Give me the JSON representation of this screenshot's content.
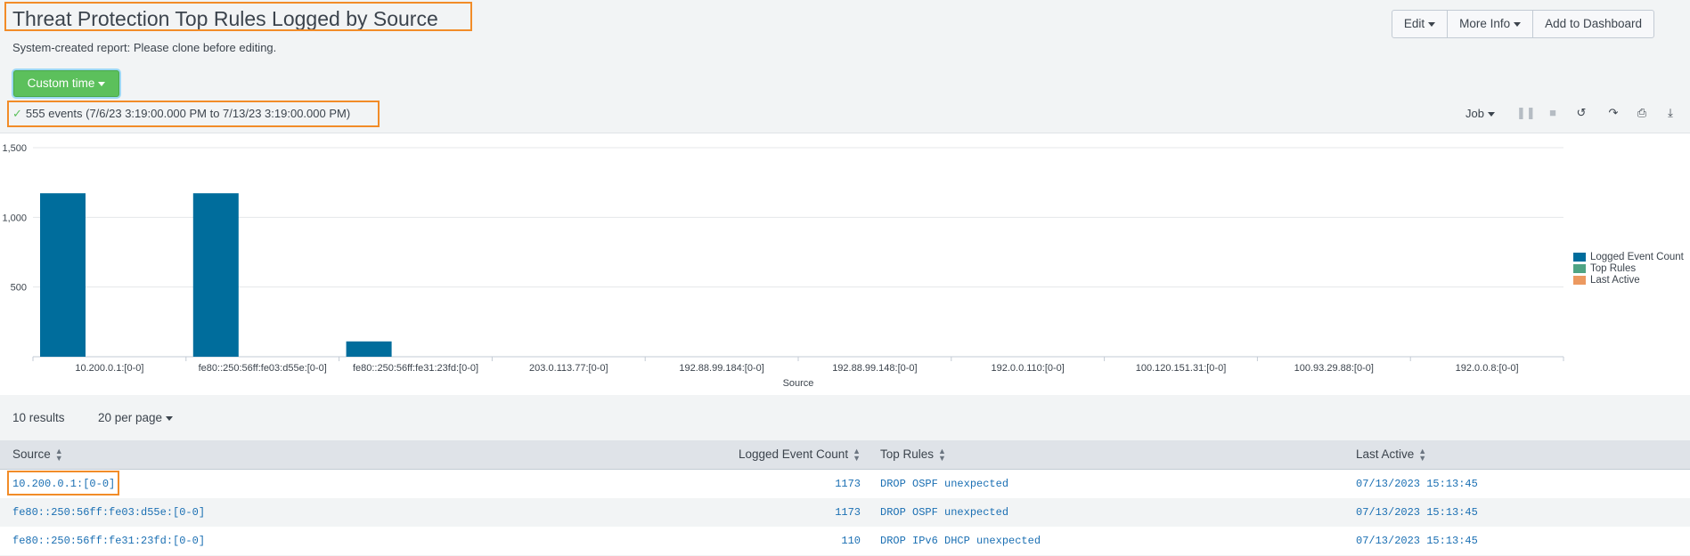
{
  "header": {
    "title": "Threat Protection Top Rules Logged by Source",
    "subtitle": "System-created report: Please clone before editing.",
    "buttons": {
      "edit": "Edit",
      "more_info": "More Info",
      "add_to_dashboard": "Add to Dashboard"
    }
  },
  "time_picker": {
    "label": "Custom time"
  },
  "status": {
    "events_text": "555 events (7/6/23 3:19:00.000 PM to 7/13/23 3:19:00.000 PM)"
  },
  "job_toolbar": {
    "job_label": "Job",
    "icons": [
      "pause-icon",
      "stop-icon",
      "refresh-icon",
      "share-icon",
      "print-icon",
      "export-icon"
    ]
  },
  "chart_data": {
    "type": "bar",
    "xlabel": "Source",
    "ylabel": "",
    "ylim": [
      0,
      1500
    ],
    "y_ticks": [
      "500",
      "1,000",
      "1,500"
    ],
    "categories": [
      "10.200.0.1:[0-0]",
      "fe80::250:56ff:fe03:d55e:[0-0]",
      "fe80::250:56ff:fe31:23fd:[0-0]",
      "203.0.113.77:[0-0]",
      "192.88.99.184:[0-0]",
      "192.88.99.148:[0-0]",
      "192.0.0.110:[0-0]",
      "100.120.151.31:[0-0]",
      "100.93.29.88:[0-0]",
      "192.0.0.8:[0-0]"
    ],
    "series": [
      {
        "name": "Logged Event Count",
        "color": "#006d9c",
        "values": [
          1173,
          1173,
          110,
          0,
          0,
          0,
          0,
          0,
          0,
          0
        ]
      },
      {
        "name": "Top Rules",
        "color": "#4fa484",
        "values": [
          0,
          0,
          0,
          0,
          0,
          0,
          0,
          0,
          0,
          0
        ]
      },
      {
        "name": "Last Active",
        "color": "#ec9960",
        "values": [
          0,
          0,
          0,
          0,
          0,
          0,
          0,
          0,
          0,
          0
        ]
      }
    ],
    "grid": true,
    "legend_position": "right"
  },
  "results": {
    "count_text": "10 results",
    "per_page": "20 per page"
  },
  "table": {
    "headers": [
      "Source",
      "Logged Event Count",
      "Top Rules",
      "Last Active"
    ],
    "rows": [
      [
        "10.200.0.1:[0-0]",
        "1173",
        "DROP OSPF unexpected",
        "07/13/2023 15:13:45"
      ],
      [
        "fe80::250:56ff:fe03:d55e:[0-0]",
        "1173",
        "DROP OSPF unexpected",
        "07/13/2023 15:13:45"
      ],
      [
        "fe80::250:56ff:fe31:23fd:[0-0]",
        "110",
        "DROP IPv6 DHCP unexpected",
        "07/13/2023 15:13:45"
      ]
    ]
  }
}
